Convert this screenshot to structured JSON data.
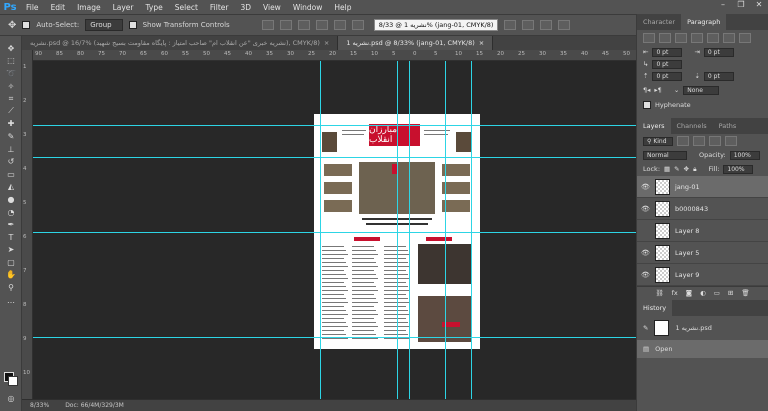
{
  "app": {
    "logo": "Ps"
  },
  "menu": [
    "File",
    "Edit",
    "Image",
    "Layer",
    "Type",
    "Select",
    "Filter",
    "3D",
    "View",
    "Window",
    "Help"
  ],
  "window_controls": [
    "–",
    "❐",
    "✕"
  ],
  "options": {
    "auto_select_label": "Auto-Select:",
    "auto_select_value": "Group",
    "show_transform_label": "Show Transform Controls"
  },
  "tooltip": "نشریه 1 @ 8/33% (jang-01, CMYK/8)",
  "tabs": [
    {
      "label": "نشریه.psd @ 16/7% (نشریه خبری \"عن انقلاب ام\" صاحب امتیاز : پایگاه مقاومت بسیج شهید), CMYK/8)",
      "active": false
    },
    {
      "label": "نشریه 1.psd @ 8/33% (jang-01, CMYK/8)",
      "active": true
    }
  ],
  "ruler_top": [
    "90",
    "85",
    "80",
    "75",
    "70",
    "65",
    "60",
    "55",
    "50",
    "45",
    "40",
    "35",
    "30",
    "25",
    "20",
    "15",
    "10",
    "5",
    "0",
    "5",
    "10",
    "15",
    "20",
    "25",
    "30",
    "35",
    "40",
    "45",
    "50"
  ],
  "ruler_left": [
    "1",
    "2",
    "3",
    "4",
    "5",
    "6",
    "7",
    "8",
    "9",
    "10"
  ],
  "document": {
    "masthead": "مبارزان انقلاب"
  },
  "status": {
    "zoom": "8/33%",
    "doc": "Doc: 66/4M/329/3M"
  },
  "panels": {
    "top_tabs": [
      "Character",
      "Paragraph"
    ],
    "indent_values": [
      "0 pt",
      "0 pt",
      "0 pt",
      "0 pt",
      "0 pt"
    ],
    "none_label": "None",
    "hyphenate_label": "Hyphenate",
    "layer_tabs": [
      "Layers",
      "Channels",
      "Paths"
    ],
    "kind_label": "Kind",
    "blend_mode": "Normal",
    "opacity_label": "Opacity:",
    "opacity_value": "100%",
    "lock_label": "Lock:",
    "fill_label": "Fill:",
    "fill_value": "100%",
    "layers": [
      {
        "name": "jang-01",
        "visible": true,
        "selected": true
      },
      {
        "name": "b0000843",
        "visible": true,
        "selected": false
      },
      {
        "name": "Layer 8",
        "visible": false,
        "selected": false
      },
      {
        "name": "Layer 5",
        "visible": true,
        "selected": false
      },
      {
        "name": "Layer 9",
        "visible": true,
        "selected": false
      }
    ],
    "history_title": "History",
    "history": [
      {
        "label": "نشریه 1.psd",
        "active": false
      },
      {
        "label": "Open",
        "active": true
      }
    ]
  }
}
